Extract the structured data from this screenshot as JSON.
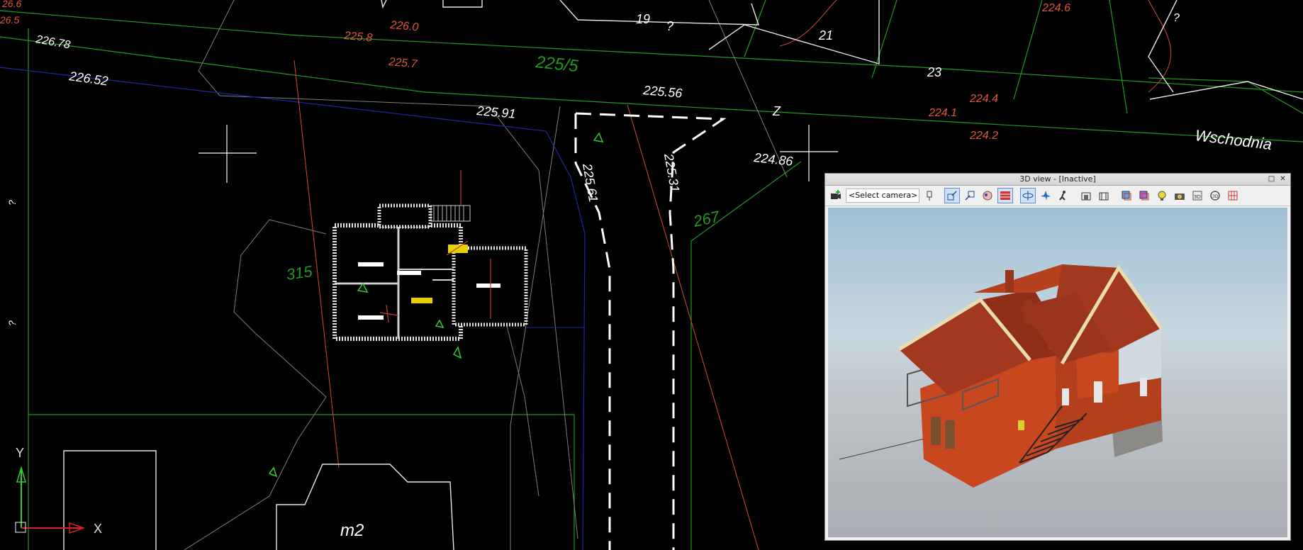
{
  "cad": {
    "labels": {
      "e266": "26.6",
      "e265": "26.5",
      "e2260": "226.0",
      "e2258": "225.8",
      "e22678": "226.78",
      "e2257": "225.7",
      "e22652": "226.52",
      "parcel2255": "225/5",
      "e22591": "225.91",
      "e22556": "225.56",
      "n19": "19",
      "q19": "?",
      "n21": "21",
      "n23": "23",
      "e2246": "224.6",
      "q_top_right": "?",
      "e2244": "224.4",
      "e2241": "224.1",
      "e2242": "224.2",
      "e22486": "224.86",
      "street": "Wschodnia",
      "z": "Z",
      "e22561": "225.61",
      "e22531": "225.31",
      "n267": "267",
      "n315": "315",
      "q_left1": "?",
      "q_left2": "?",
      "axis_y": "Y",
      "axis_x": "X",
      "m2": "m2"
    }
  },
  "panel3d": {
    "title": "3D view - [Inactive]",
    "restore_icon": "□",
    "close_icon": "✕",
    "camera_select": "<Select camera>"
  },
  "colors": {
    "background": "#000000",
    "green_line": "#1f9a1f",
    "red_text": "#e0563c",
    "white_text": "#ffffff",
    "panel_bg": "#f0f0f0",
    "sky_top": "#9fc0d4",
    "ground": "#a9adb3",
    "brick": "#c8471e",
    "roof": "#a33820"
  },
  "toolbar_icons": [
    "add-camera-icon",
    "pin-icon",
    "zoom-extents-icon",
    "zoom-window-icon",
    "render-mode-icon",
    "texture-icon",
    "orbit-icon",
    "fly-icon",
    "walk-icon",
    "section-icon",
    "section2-icon",
    "layers-icon",
    "layers2-icon",
    "light-icon",
    "camera-capture-icon",
    "3d-pdf-icon",
    "rotate-icon",
    "grid-icon"
  ]
}
